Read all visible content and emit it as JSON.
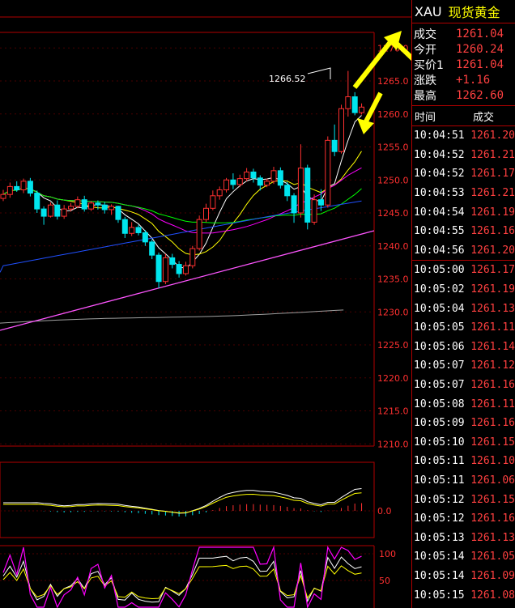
{
  "header": {
    "symbol": "XAU",
    "name": "现货黄金"
  },
  "quote": [
    {
      "label": "成交",
      "value": "1261.04"
    },
    {
      "label": "今开",
      "value": "1260.24"
    },
    {
      "label": "买价1",
      "value": "1261.04"
    },
    {
      "label": "涨跌",
      "value": "+1.16"
    },
    {
      "label": "最高",
      "value": "1262.60"
    }
  ],
  "ticks_header": {
    "time": "时间",
    "price": "成交"
  },
  "ticks": [
    {
      "time": "10:04:51",
      "price": "1261.20"
    },
    {
      "time": "10:04:52",
      "price": "1261.21"
    },
    {
      "time": "10:04:52",
      "price": "1261.17"
    },
    {
      "time": "10:04:53",
      "price": "1261.21"
    },
    {
      "time": "10:04:54",
      "price": "1261.19"
    },
    {
      "time": "10:04:55",
      "price": "1261.16"
    },
    {
      "time": "10:04:56",
      "price": "1261.20"
    },
    {
      "time": "10:05:00",
      "price": "1261.17"
    },
    {
      "time": "10:05:02",
      "price": "1261.19"
    },
    {
      "time": "10:05:04",
      "price": "1261.13"
    },
    {
      "time": "10:05:05",
      "price": "1261.11"
    },
    {
      "time": "10:05:06",
      "price": "1261.14"
    },
    {
      "time": "10:05:07",
      "price": "1261.12"
    },
    {
      "time": "10:05:07",
      "price": "1261.16"
    },
    {
      "time": "10:05:08",
      "price": "1261.11"
    },
    {
      "time": "10:05:09",
      "price": "1261.16"
    },
    {
      "time": "10:05:10",
      "price": "1261.15"
    },
    {
      "time": "10:05:11",
      "price": "1261.10"
    },
    {
      "time": "10:05:11",
      "price": "1261.06"
    },
    {
      "time": "10:05:12",
      "price": "1261.15"
    },
    {
      "time": "10:05:12",
      "price": "1261.16"
    },
    {
      "time": "10:05:13",
      "price": "1261.13"
    },
    {
      "time": "10:05:14",
      "price": "1261.05"
    },
    {
      "time": "10:05:14",
      "price": "1261.09"
    },
    {
      "time": "10:05:15",
      "price": "1261.08"
    }
  ],
  "chart": {
    "price_labels": [
      "1266.52"
    ],
    "y_ticks": [
      "1270.0",
      "1265.0",
      "1260.0",
      "1255.0",
      "1250.0",
      "1245.0",
      "1240.0",
      "1235.0",
      "1230.0",
      "1225.0",
      "1220.0",
      "1215.0",
      "1210.0"
    ],
    "macd_ticks": [
      "0.0"
    ],
    "osc_ticks": [
      "100",
      "50"
    ],
    "colors": {
      "up": "#000000",
      "up_border": "#ff3030",
      "down": "#00e5ee",
      "ma5": "#ffffff",
      "ma10": "#ffff00",
      "ma20": "#ff00ff",
      "ma30": "#00ff00",
      "ma60": "#2050ff",
      "trend": "#ff55ff",
      "ma250": "#a0a0a0",
      "annotation_arrow": "#ffff00"
    }
  },
  "candles": [
    [
      1247.2,
      1248.5,
      1246.8,
      1247.8
    ],
    [
      1247.8,
      1249.6,
      1247.3,
      1249.0
    ],
    [
      1249.0,
      1249.8,
      1248.2,
      1248.5
    ],
    [
      1248.5,
      1250.2,
      1248.0,
      1249.8
    ],
    [
      1249.8,
      1250.3,
      1247.5,
      1248.0
    ],
    [
      1248.0,
      1248.4,
      1245.0,
      1245.6
    ],
    [
      1245.6,
      1246.0,
      1243.2,
      1244.5
    ],
    [
      1244.5,
      1246.6,
      1244.3,
      1246.2
    ],
    [
      1246.2,
      1246.9,
      1244.0,
      1244.5
    ],
    [
      1244.5,
      1246.2,
      1244.1,
      1245.6
    ],
    [
      1245.6,
      1246.5,
      1245.2,
      1246.0
    ],
    [
      1246.0,
      1247.5,
      1245.7,
      1247.0
    ],
    [
      1247.0,
      1247.6,
      1245.2,
      1245.6
    ],
    [
      1245.6,
      1246.8,
      1245.3,
      1246.5
    ],
    [
      1246.5,
      1246.9,
      1245.5,
      1246.2
    ],
    [
      1246.2,
      1246.7,
      1244.9,
      1245.5
    ],
    [
      1245.5,
      1246.3,
      1244.7,
      1246.0
    ],
    [
      1246.0,
      1246.1,
      1243.5,
      1244.0
    ],
    [
      1244.0,
      1244.4,
      1241.2,
      1241.9
    ],
    [
      1241.9,
      1243.6,
      1241.5,
      1242.8
    ],
    [
      1242.8,
      1243.2,
      1241.6,
      1242.0
    ],
    [
      1242.0,
      1242.4,
      1240.0,
      1240.6
    ],
    [
      1240.6,
      1241.0,
      1238.0,
      1238.6
    ],
    [
      1238.6,
      1239.0,
      1233.6,
      1234.6
    ],
    [
      1234.6,
      1238.8,
      1234.2,
      1238.2
    ],
    [
      1238.2,
      1238.8,
      1236.6,
      1237.2
    ],
    [
      1237.2,
      1237.7,
      1235.2,
      1235.8
    ],
    [
      1235.8,
      1237.6,
      1235.5,
      1237.0
    ],
    [
      1237.0,
      1240.0,
      1236.6,
      1239.6
    ],
    [
      1239.6,
      1244.6,
      1239.3,
      1244.0
    ],
    [
      1244.0,
      1246.4,
      1243.6,
      1245.7
    ],
    [
      1245.7,
      1248.4,
      1245.4,
      1247.6
    ],
    [
      1247.6,
      1249.0,
      1247.0,
      1248.5
    ],
    [
      1248.5,
      1250.3,
      1248.1,
      1250.0
    ],
    [
      1250.0,
      1251.0,
      1248.6,
      1249.3
    ],
    [
      1249.3,
      1250.8,
      1248.9,
      1250.2
    ],
    [
      1250.2,
      1251.8,
      1249.8,
      1251.2
    ],
    [
      1251.2,
      1251.7,
      1249.6,
      1250.3
    ],
    [
      1250.3,
      1250.7,
      1248.4,
      1249.2
    ],
    [
      1249.2,
      1250.2,
      1248.9,
      1249.8
    ],
    [
      1249.8,
      1252.0,
      1249.4,
      1251.4
    ],
    [
      1251.4,
      1251.9,
      1248.7,
      1249.2
    ],
    [
      1249.2,
      1249.7,
      1246.8,
      1247.6
    ],
    [
      1247.6,
      1248.0,
      1243.5,
      1245.0
    ],
    [
      1245.0,
      1255.4,
      1244.3,
      1251.8
    ],
    [
      1251.8,
      1252.3,
      1242.5,
      1243.6
    ],
    [
      1243.6,
      1247.8,
      1243.2,
      1247.0
    ],
    [
      1247.0,
      1248.6,
      1245.3,
      1246.2
    ],
    [
      1246.2,
      1256.6,
      1245.8,
      1256.0
    ],
    [
      1256.0,
      1258.4,
      1253.6,
      1254.3
    ],
    [
      1254.3,
      1261.4,
      1254.0,
      1260.8
    ],
    [
      1260.8,
      1266.52,
      1259.6,
      1262.6
    ],
    [
      1262.6,
      1263.3,
      1259.8,
      1260.2
    ],
    [
      1260.2,
      1261.6,
      1259.9,
      1261.04
    ]
  ]
}
